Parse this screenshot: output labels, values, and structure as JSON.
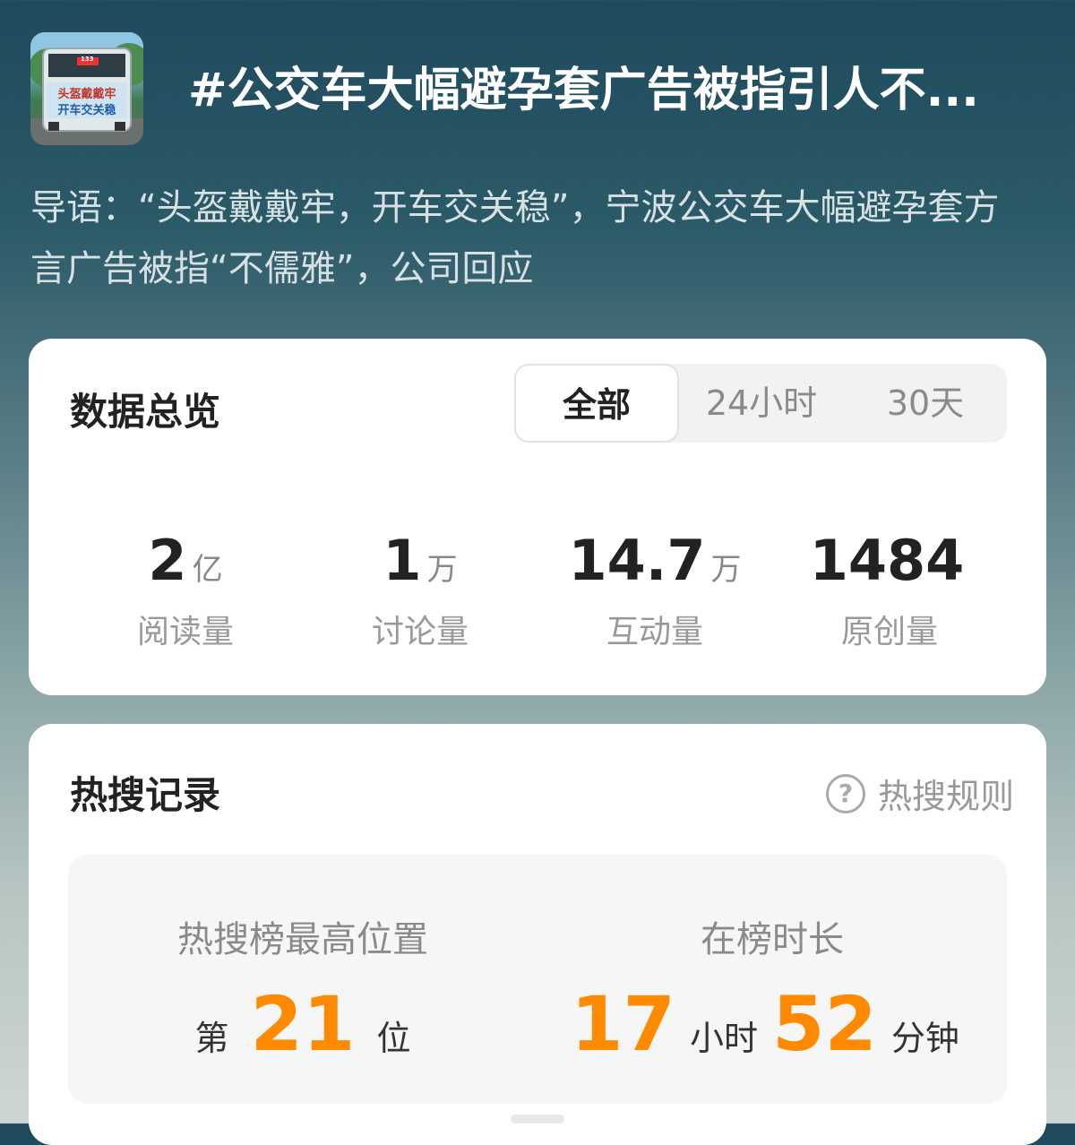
{
  "header": {
    "title": "#公交车大幅避孕套广告被指引人不...",
    "intro": "导语：“头盔戴戴牢，开车交关稳”，宁波公交车大幅避孕套方言广告被指“不儒雅”，公司回应",
    "thumb_text": [
      "头盔戴戴牢",
      "开车交关稳"
    ],
    "thumb_bus_number": "133"
  },
  "overview": {
    "title": "数据总览",
    "tabs": [
      {
        "label": "全部",
        "active": true
      },
      {
        "label": "24小时",
        "active": false
      },
      {
        "label": "30天",
        "active": false
      }
    ],
    "stats": [
      {
        "value": "2",
        "unit": "亿",
        "label": "阅读量"
      },
      {
        "value": "1",
        "unit": "万",
        "label": "讨论量"
      },
      {
        "value": "14.7",
        "unit": "万",
        "label": "互动量"
      },
      {
        "value": "1484",
        "unit": "",
        "label": "原创量"
      }
    ]
  },
  "hot": {
    "title": "热搜记录",
    "rules_label": "热搜规则",
    "rules_icon": "question-circle-icon",
    "max_position": {
      "label": "热搜榜最高位置",
      "prefix": "第",
      "value": "21",
      "suffix": "位"
    },
    "duration": {
      "label": "在榜时长",
      "hours": "17",
      "hours_unit": "小时",
      "minutes": "52",
      "minutes_unit": "分钟"
    }
  },
  "colors": {
    "accent": "#ff8a00",
    "card_bg": "#ffffff",
    "bg_top": "#1f4a5c"
  }
}
